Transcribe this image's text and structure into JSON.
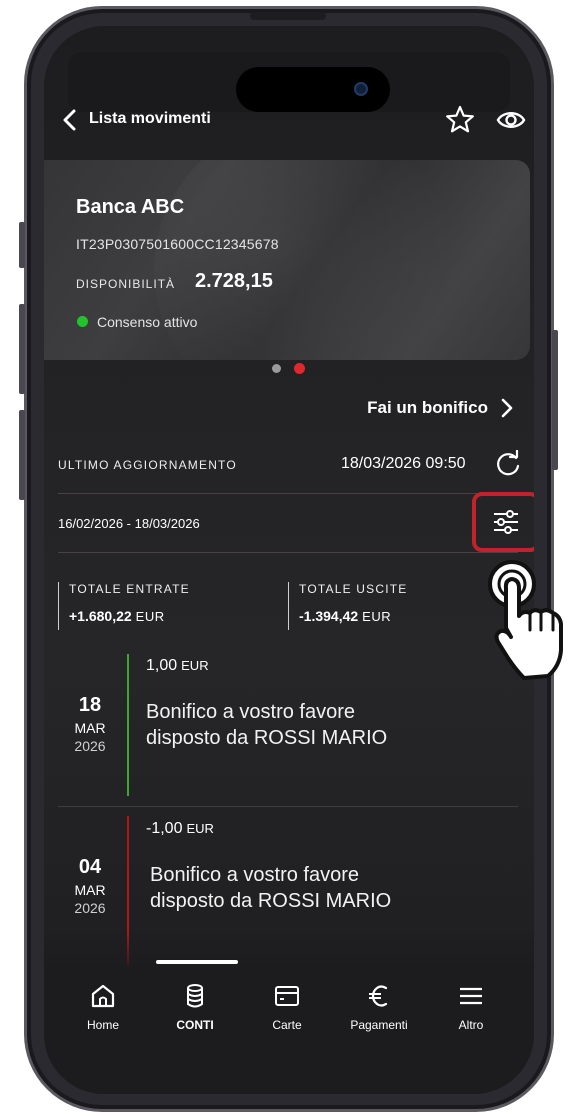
{
  "header": {
    "title": "Lista movimenti"
  },
  "account": {
    "bank_name": "Banca ABC",
    "iban": "IT23P0307501600CC12345678",
    "availability_label": "DISPONIBILITÀ",
    "availability_value": "2.728,15",
    "consent_text": "Consenso attivo",
    "consent_color": "#22c32c"
  },
  "pager": {
    "count": 2,
    "active_index": 1,
    "active_color": "#e0272e",
    "inactive_color": "#9a9a9a"
  },
  "transfer": {
    "label": "Fai un bonifico"
  },
  "update": {
    "label": "ULTIMO AGGIORNAMENTO",
    "value": "18/03/2026 09:50"
  },
  "filter": {
    "date_range": "16/02/2026 - 18/03/2026",
    "highlight_color": "#c2232b"
  },
  "totals": {
    "income_label": "TOTALE ENTRATE",
    "income_value": "+1.680,22",
    "expense_label": "TOTALE USCITE",
    "expense_value": "-1.394,42",
    "currency": "EUR"
  },
  "transactions": [
    {
      "amount": "1,00",
      "currency": "EUR",
      "day": "18",
      "month": "MAR",
      "year": "2026",
      "description_line1": "Bonifico a vostro favore",
      "description_line2": "disposto da ROSSI MARIO",
      "bar_color": "#3fa535"
    },
    {
      "amount": "-1,00",
      "currency": "EUR",
      "day": "04",
      "month": "MAR",
      "year": "2026",
      "description_line1": "Bonifico a vostro favore",
      "description_line2": "disposto da ROSSI MARIO",
      "bar_color": "#b3151c"
    }
  ],
  "tabbar": {
    "items": [
      {
        "label": "Home",
        "icon": "home-icon"
      },
      {
        "label": "CONTI",
        "icon": "database-icon"
      },
      {
        "label": "Carte",
        "icon": "card-icon"
      },
      {
        "label": "Pagamenti",
        "icon": "euro-icon"
      },
      {
        "label": "Altro",
        "icon": "menu-icon"
      }
    ],
    "active_index": 1
  }
}
